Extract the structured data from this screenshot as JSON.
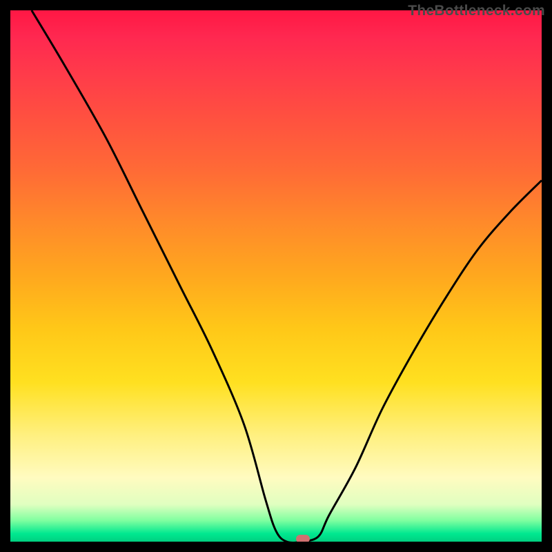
{
  "watermark_text": "TheBottleneck.com",
  "chart_data": {
    "type": "line",
    "title": "",
    "xlabel": "",
    "ylabel": "",
    "xlim": [
      0,
      100
    ],
    "ylim": [
      0,
      100
    ],
    "x": [
      4,
      10,
      18,
      25,
      32,
      38,
      44,
      48,
      50,
      52,
      55,
      58,
      60,
      65,
      70,
      76,
      82,
      88,
      94,
      100
    ],
    "y": [
      100,
      90,
      76,
      62,
      48,
      36,
      22,
      8,
      2,
      0,
      0,
      1,
      5,
      14,
      25,
      36,
      46,
      55,
      62,
      68
    ],
    "note": "V-shaped bottleneck curve. y represents bottleneck percentage (top=100%, bottom=0%). x is relative hardware balance axis. Minimum around x≈53.",
    "marker": {
      "x": 55,
      "y": 0.5
    },
    "background_gradient": {
      "top_color": "#ff1744",
      "mid_color": "#ffd020",
      "bottom_color": "#00d080"
    }
  }
}
